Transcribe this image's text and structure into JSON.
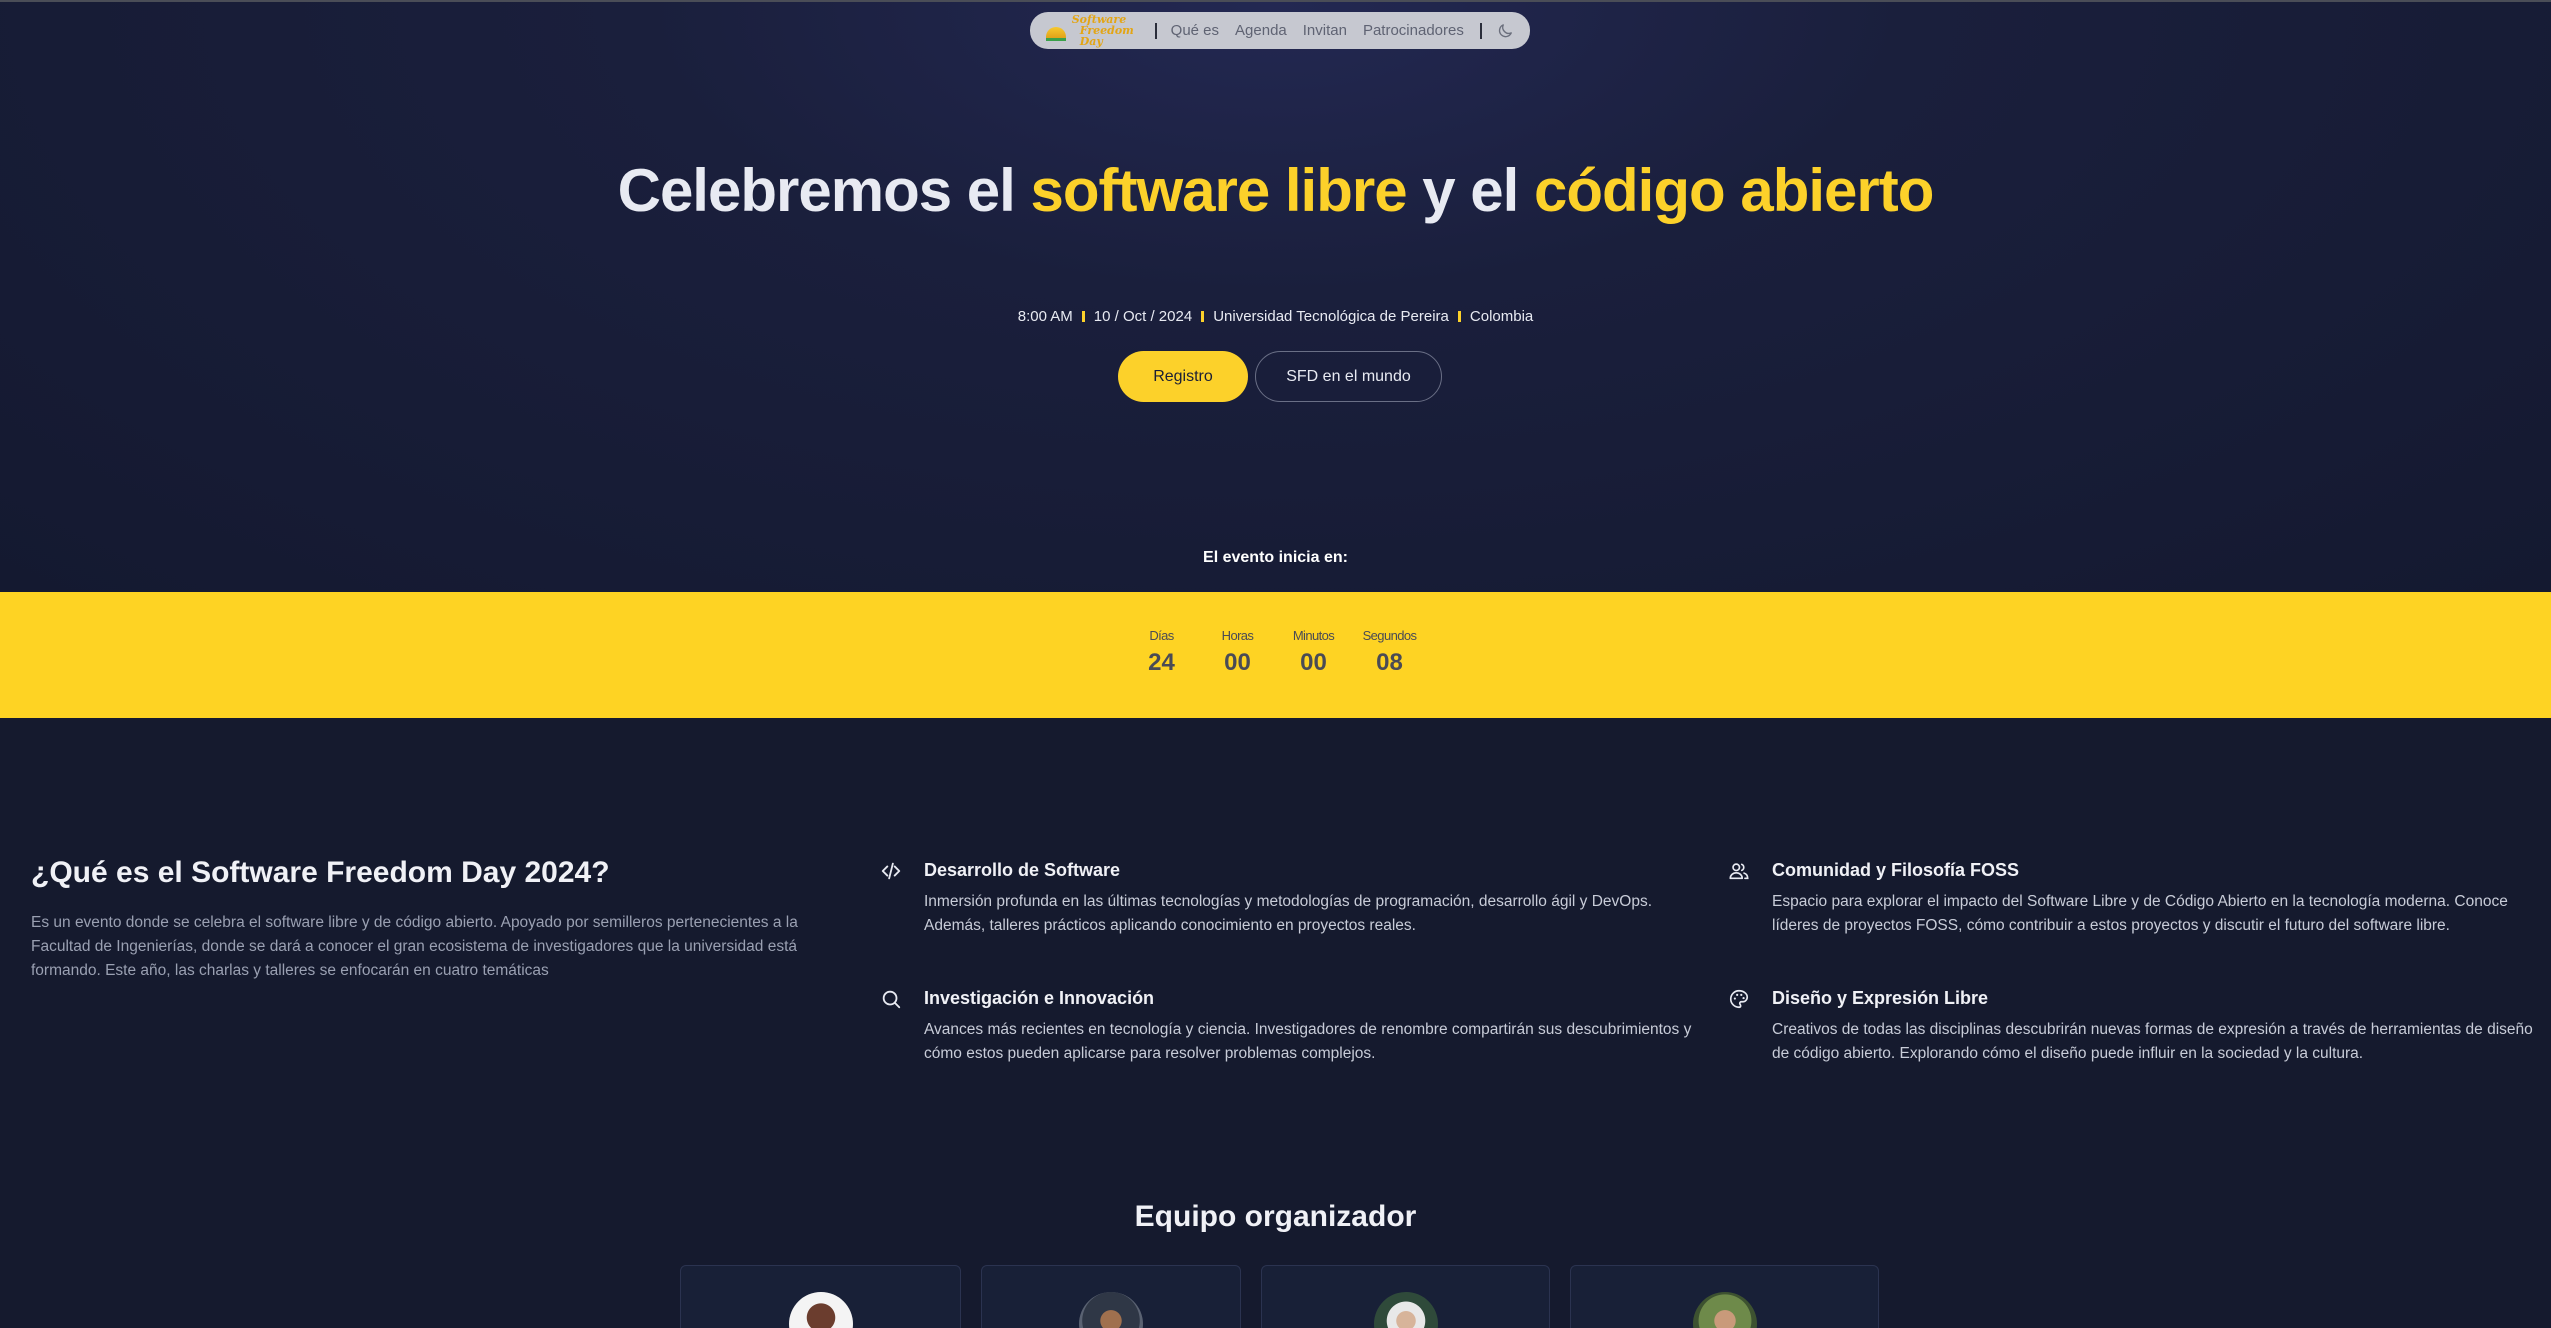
{
  "nav": {
    "logo_line1": "Software",
    "logo_line2": "Freedom Day",
    "links": [
      "Qué es",
      "Agenda",
      "Invitan",
      "Patrocinadores"
    ]
  },
  "hero": {
    "title_part1": "Celebremos el ",
    "title_hl1": "software libre",
    "title_part2": " y el ",
    "title_hl2": "código abierto",
    "meta": [
      "8:00 AM",
      "10 / Oct / 2024",
      "Universidad Tecnológica de Pereira",
      "Colombia"
    ],
    "register_label": "Registro",
    "world_label": "SFD en el mundo"
  },
  "countdown": {
    "label": "El evento inicia en:",
    "units": [
      {
        "name": "Días",
        "value": "24"
      },
      {
        "name": "Horas",
        "value": "00"
      },
      {
        "name": "Minutos",
        "value": "00"
      },
      {
        "name": "Segundos",
        "value": "08"
      }
    ]
  },
  "about": {
    "title": "¿Qué es el Software Freedom Day 2024?",
    "description": "Es un evento donde se celebra el software libre y de código abierto. Apoyado por semilleros pertenecientes a la Facultad de Ingenierías, donde se dará a conocer el gran ecosistema de investigadores que la universidad está formando. Este año, las charlas y talleres se enfocarán en cuatro temáticas",
    "features": [
      {
        "icon": "code-icon",
        "title": "Desarrollo de Software",
        "text": "Inmersión profunda en las últimas tecnologías y metodologías de programación, desarrollo ágil y DevOps. Además, talleres prácticos aplicando conocimiento en proyectos reales."
      },
      {
        "icon": "users-icon",
        "title": "Comunidad y Filosofía FOSS",
        "text": "Espacio para explorar el impacto del Software Libre y de Código Abierto en la tecnología moderna. Conoce líderes de proyectos FOSS, cómo contribuir a estos proyectos y discutir el futuro del software libre."
      },
      {
        "icon": "search-icon",
        "title": "Investigación e Innovación",
        "text": "Avances más recientes en tecnología y ciencia. Investigadores de renombre compartirán sus descubrimientos y cómo estos pueden aplicarse para resolver problemas complejos."
      },
      {
        "icon": "palette-icon",
        "title": "Diseño y Expresión Libre",
        "text": "Creativos de todas las disciplinas descubrirán nuevas formas de expresión a través de herramientas de diseño de código abierto. Explorando cómo el diseño puede influir en la sociedad y la cultura."
      }
    ]
  },
  "team": {
    "title": "Equipo organizador"
  },
  "colors": {
    "accent": "#fcd12a",
    "background": "#151a2e",
    "countdown_band": "#fed323"
  }
}
